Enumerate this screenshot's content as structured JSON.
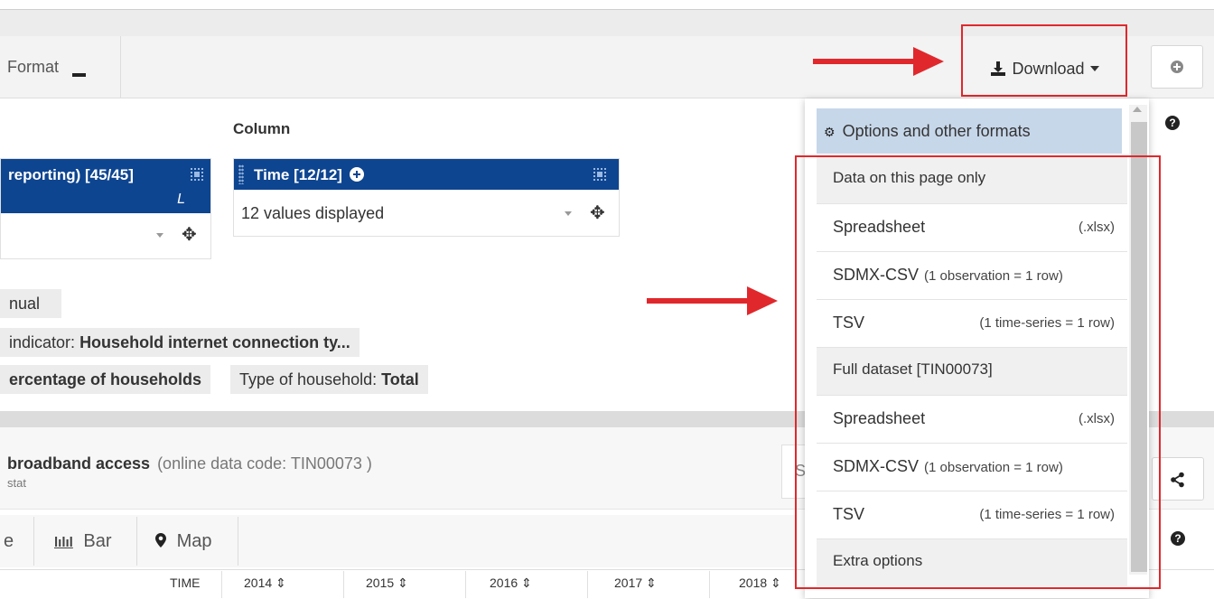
{
  "toolbar": {
    "format_label": "Format",
    "download_label": "Download"
  },
  "column_section": {
    "title": "Column",
    "left_card": {
      "header": "reporting) [45/45]",
      "extra": "L"
    },
    "right_card": {
      "header": "Time [12/12]",
      "value": "12 values displayed"
    }
  },
  "filters": {
    "annual": "nual",
    "indicator_label": "indicator:",
    "indicator_value": "Household internet connection ty...",
    "unit_value": "ercentage of households",
    "type_label": "Type of household:",
    "type_value": "Total"
  },
  "dataset": {
    "title": "broadband access",
    "code": "(online data code: TIN00073 )",
    "source": "stat",
    "search_fragment": "S"
  },
  "tabs": [
    {
      "label": "e"
    },
    {
      "label": "Bar"
    },
    {
      "label": "Map"
    }
  ],
  "time_header": {
    "label": "TIME",
    "years": [
      "2014",
      "2015",
      "2016",
      "2017",
      "2018"
    ]
  },
  "download_menu": {
    "options_label": "Options and other formats",
    "section_page": "Data on this page only",
    "section_full": "Full dataset [TIN00073]",
    "section_extra": "Extra options",
    "items_page": [
      {
        "label": "Spreadsheet",
        "note": "(.xlsx)"
      },
      {
        "label": "SDMX-CSV",
        "note": "(1 observation = 1 row)"
      },
      {
        "label": "TSV",
        "note": "(1 time-series = 1 row)"
      }
    ],
    "items_full": [
      {
        "label": "Spreadsheet",
        "note": "(.xlsx)"
      },
      {
        "label": "SDMX-CSV",
        "note": "(1 observation = 1 row)"
      },
      {
        "label": "TSV",
        "note": "(1 time-series = 1 row)"
      }
    ]
  },
  "colors": {
    "accent_blue": "#0e4590",
    "highlight_red": "#e0282c",
    "menu_selected": "#c7d7ea"
  }
}
